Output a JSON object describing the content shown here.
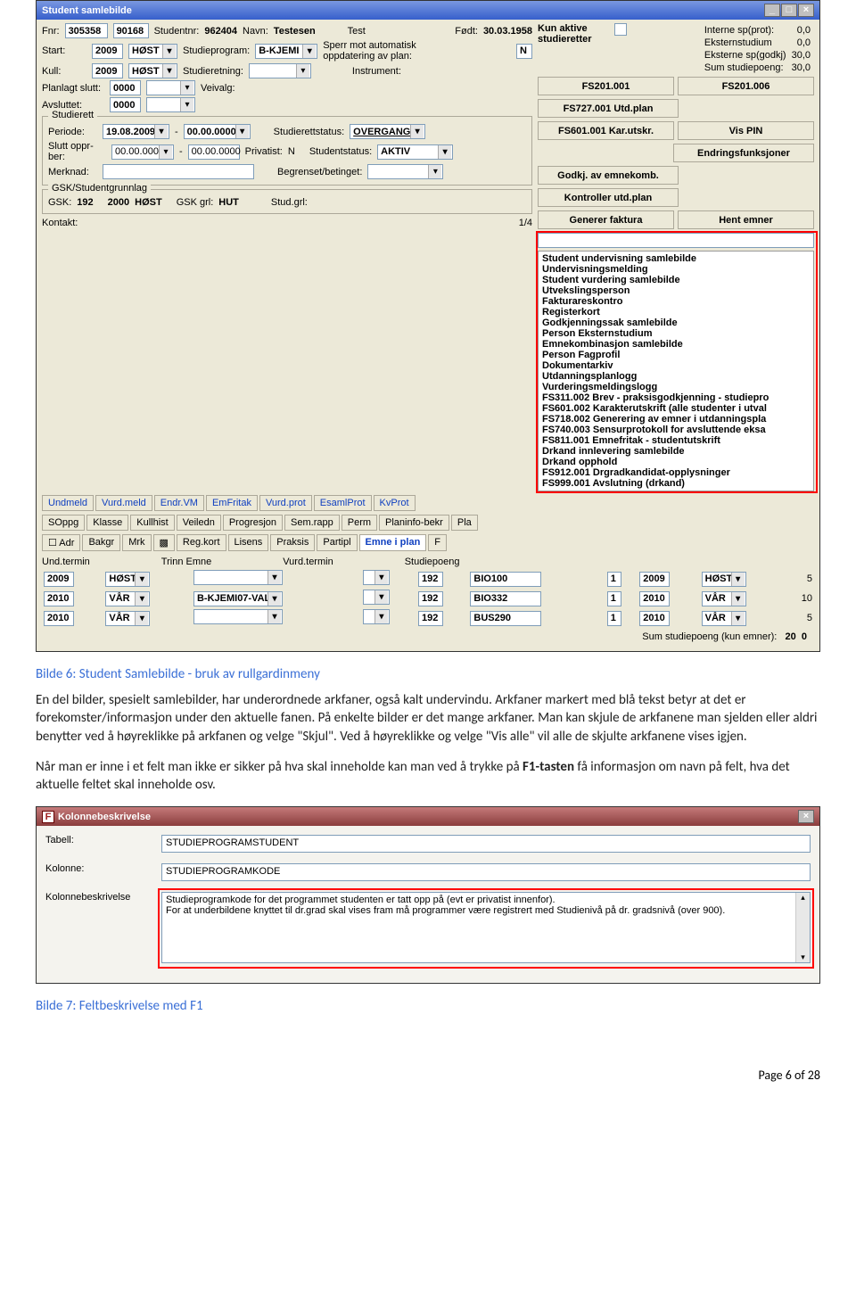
{
  "fig1": {
    "title": "Student samlebilde",
    "fnr_lbl": "Fnr:",
    "fnr1": "305358",
    "fnr2": "90168",
    "studnr_lbl": "Studentnr:",
    "studnr": "962404",
    "navn_lbl": "Navn:",
    "navn_last": "Testesen",
    "navn_first": "Test",
    "fodt_lbl": "Født:",
    "fodt": "30.03.1958",
    "start_lbl": "Start:",
    "start_year": "2009",
    "start_sem": "HØST",
    "studprog_lbl": "Studieprogram:",
    "studprog": "B-KJEMI",
    "sperr_lbl": "Sperr mot automatisk oppdatering av plan:",
    "sperr_val": "N",
    "kull_lbl": "Kull:",
    "kull_year": "2009",
    "kull_sem": "HØST",
    "studieretn_lbl": "Studieretning:",
    "instr_lbl": "Instrument:",
    "planlagt_lbl": "Planlagt slutt:",
    "planlagt": "0000",
    "avsluttet_lbl": "Avsluttet:",
    "avsluttet": "0000",
    "veivalg_lbl": "Veivalg:",
    "studierett_title": "Studierett",
    "periode_lbl": "Periode:",
    "periode_a": "19.08.2009",
    "periode_b": "00.00.0000",
    "srstatus_lbl": "Studierettstatus:",
    "srstatus": "OVERGANG",
    "slutt_lbl": "Slutt oppr-ber:",
    "slutt_a": "00.00.0000",
    "slutt_b": "00.00.0000",
    "privat_lbl": "Privatist:",
    "privat": "N",
    "studstatus_lbl": "Studentstatus:",
    "studstatus": "AKTIV",
    "merknad_lbl": "Merknad:",
    "begr_lbl": "Begrenset/betinget:",
    "gsk_title": "GSK/Studentgrunnlag",
    "gsk_lbl": "GSK:",
    "gsk": "192",
    "gsk_year": "2000",
    "gsk_sem": "HØST",
    "gsk_grl_lbl": "GSK grl:",
    "gsk_grl": "HUT",
    "studgrl_lbl": "Stud.grl:",
    "kontakt_lbl": "Kontakt:",
    "pager": "1/4",
    "kun_aktive": "Kun aktive studieretter",
    "stats": {
      "a": "Interne sp(prot):",
      "av": "0,0",
      "b": "Eksternstudium",
      "bv": "0,0",
      "c": "Eksterne sp(godkj)",
      "cv": "30,0",
      "d": "Sum studiepoeng:",
      "dv": "30,0"
    },
    "right_buttons": [
      [
        "FS201.001",
        "FS201.006"
      ],
      [
        "FS727.001 Utd.plan",
        ""
      ],
      [
        "FS601.001 Kar.utskr.",
        "Vis PIN"
      ],
      [
        "",
        "Endringsfunksjoner"
      ],
      [
        "Godkj. av emnekomb.",
        ""
      ],
      [
        "Kontroller utd.plan",
        ""
      ],
      [
        "Generer faktura",
        "Hent emner"
      ]
    ],
    "tabs_row1": [
      "Undmeld",
      "Vurd.meld",
      "Endr.VM",
      "EmFritak",
      "Vurd.prot",
      "EsamlProt",
      "KvProt"
    ],
    "tabs_row2": [
      "SOppg",
      "Klasse",
      "Kullhist",
      "Veiledn",
      "Progresjon",
      "Sem.rapp",
      "Perm",
      "Planinfo-bekr",
      "Pla"
    ],
    "tabs_row3": [
      "☐ Adr",
      "Bakgr",
      "Mrk",
      "▩",
      "Reg.kort",
      "Lisens",
      "Praksis",
      "Partipl",
      "Emne i plan",
      "F"
    ],
    "hdrs": {
      "a": "Und.termin",
      "b": "Trinn Emne",
      "c": "Vurd.termin",
      "d": "Studiepoeng"
    },
    "rows": [
      {
        "y1": "2009",
        "s1": "HØST",
        "prog": "",
        "trinn": "",
        "emnekd": "192",
        "emne": "BIO100",
        "col": "1",
        "y2": "2009",
        "s2": "HØST",
        "sp": "5"
      },
      {
        "y1": "2010",
        "s1": "VÅR",
        "prog": "B-KJEMI07-VAL",
        "trinn": "",
        "emnekd": "192",
        "emne": "BIO332",
        "col": "1",
        "y2": "2010",
        "s2": "VÅR",
        "sp": "10"
      },
      {
        "y1": "2010",
        "s1": "VÅR",
        "prog": "",
        "trinn": "",
        "emnekd": "192",
        "emne": "BUS290",
        "col": "1",
        "y2": "2010",
        "s2": "VÅR",
        "sp": "5"
      }
    ],
    "sum_lbl": "Sum studiepoeng (kun emner):",
    "sum_a": "20",
    "sum_b": "0",
    "menu": [
      "Student undervisning samlebilde",
      "Undervisningsmelding",
      "Student vurdering samlebilde",
      "Utvekslingsperson",
      "Fakturareskontro",
      "Registerkort",
      "Godkjenningssak samlebilde",
      "Person Eksternstudium",
      "Emnekombinasjon samlebilde",
      "Person Fagprofil",
      "Dokumentarkiv",
      "Utdanningsplanlogg",
      "Vurderingsmeldingslogg",
      "FS311.002 Brev - praksisgodkjenning - studiepro",
      "FS601.002 Karakterutskrift (alle studenter i utval",
      "FS718.002 Generering av emner i utdanningspla",
      "FS740.003 Sensurprotokoll for avsluttende eksa",
      "FS811.001 Emnefritak - studentutskrift",
      "Drkand innlevering samlebilde",
      "Drkand opphold",
      "FS912.001 Drgradkandidat-opplysninger",
      "FS999.001 Avslutning (drkand)"
    ]
  },
  "captions": {
    "c6": "Bilde 6: Student Samlebilde - bruk av rullgardinmeny",
    "c7": "Bilde 7: Feltbeskrivelse med F1"
  },
  "paragraphs": {
    "p1": "En del bilder, spesielt samlebilder, har underordnede arkfaner, også kalt undervindu. Arkfaner markert med blå tekst betyr at det er forekomster/informasjon under den aktuelle fanen. På enkelte bilder er det mange arkfaner. Man kan skjule de arkfanene man sjelden eller aldri benytter ved å høyreklikke på arkfanen og velge \"Skjul\". Ved å høyreklikke og velge \"Vis alle\" vil alle de skjulte arkfanene vises igjen.",
    "p2a": "Når man er inne i et felt man ikke er sikker på hva skal inneholde kan man ved å trykke på ",
    "p2b": "F1-tasten",
    "p2c": " få informasjon om navn på felt, hva det aktuelle feltet skal inneholde osv."
  },
  "dialog": {
    "title": "Kolonnebeskrivelse",
    "tabell_lbl": "Tabell:",
    "tabell": "STUDIEPROGRAMSTUDENT",
    "kolonne_lbl": "Kolonne:",
    "kolonne": "STUDIEPROGRAMKODE",
    "beskr_lbl": "Kolonnebeskrivelse",
    "beskr": "Studieprogramkode for det programmet studenten er tatt opp på (evt er privatist innenfor).\nFor at underbildene knyttet til dr.grad skal vises fram må programmer være registrert med Studienivå på dr. gradsnivå (over 900)."
  },
  "footer": "Page 6 of 28"
}
